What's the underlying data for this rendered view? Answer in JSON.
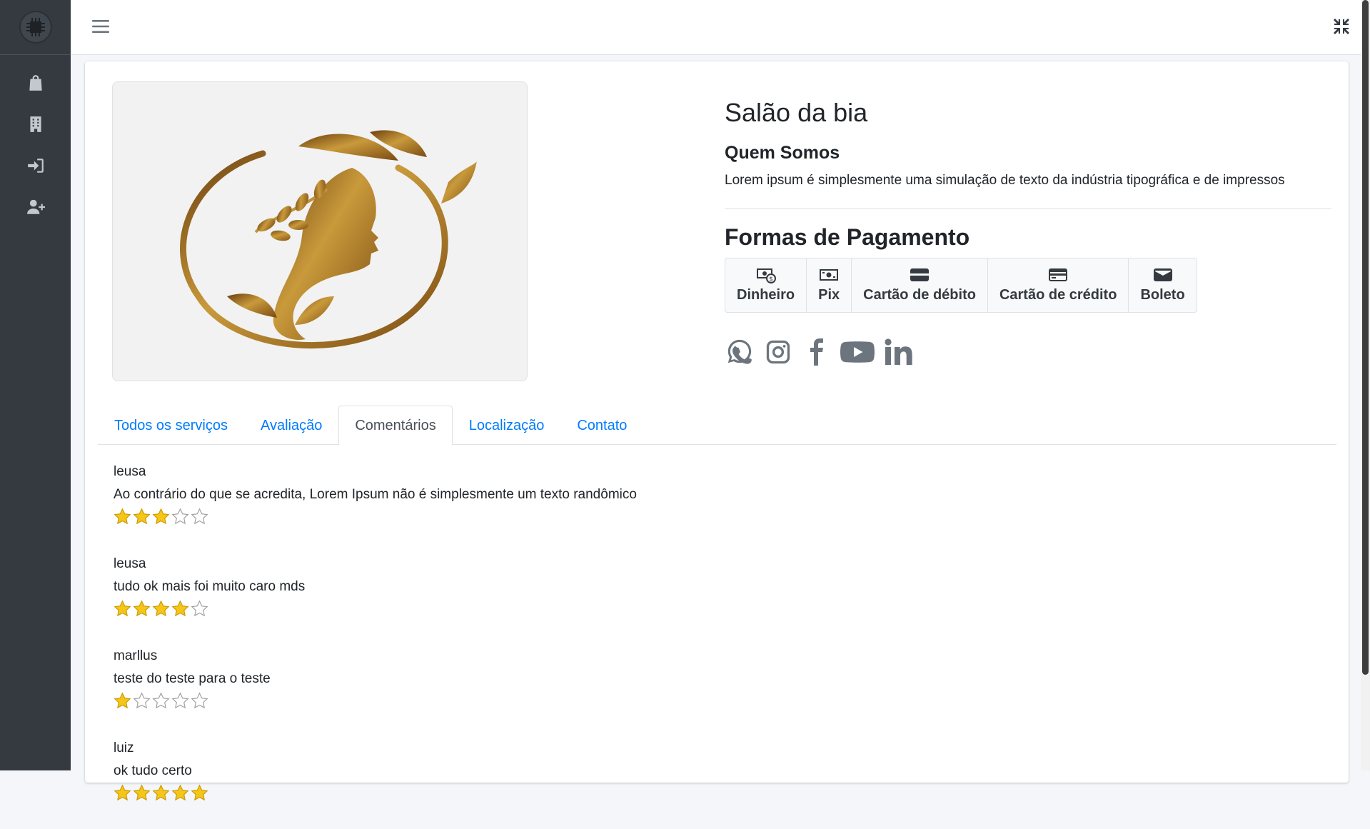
{
  "business": {
    "name": "Salão da bia",
    "about_title": "Quem Somos",
    "about_text": "Lorem ipsum é simplesmente uma simulação de texto da indústria tipográfica e de impressos",
    "payments_title": "Formas de Pagamento",
    "payments": [
      {
        "label": "Dinheiro",
        "icon": "money-icon"
      },
      {
        "label": "Pix",
        "icon": "pix-icon"
      },
      {
        "label": "Cartão de débito",
        "icon": "debit-card-icon"
      },
      {
        "label": "Cartão de crédito",
        "icon": "credit-card-icon"
      },
      {
        "label": "Boleto",
        "icon": "boleto-icon"
      }
    ],
    "social": [
      "whatsapp-icon",
      "instagram-icon",
      "facebook-icon",
      "youtube-icon",
      "linkedin-icon"
    ]
  },
  "sidebar": {
    "items": [
      {
        "icon": "shopping-bag-icon"
      },
      {
        "icon": "building-icon"
      },
      {
        "icon": "sign-in-icon"
      },
      {
        "icon": "user-plus-icon"
      }
    ]
  },
  "tabs": [
    {
      "label": "Todos os serviços",
      "active": false
    },
    {
      "label": "Avaliação",
      "active": false
    },
    {
      "label": "Comentários",
      "active": true
    },
    {
      "label": "Localização",
      "active": false
    },
    {
      "label": "Contato",
      "active": false
    }
  ],
  "comments": [
    {
      "user": "leusa",
      "text": "Ao contrário do que se acredita, Lorem Ipsum não é simplesmente um texto randômico",
      "rating": 3
    },
    {
      "user": "leusa",
      "text": "tudo ok mais foi muito caro mds",
      "rating": 4
    },
    {
      "user": "marllus",
      "text": "teste do teste para o teste",
      "rating": 1
    },
    {
      "user": "luiz",
      "text": "ok tudo certo",
      "rating": 5
    }
  ],
  "colors": {
    "sidebar": "#343a40",
    "link": "#007bff",
    "star": "#f5c518",
    "gold": "#a8741a"
  }
}
